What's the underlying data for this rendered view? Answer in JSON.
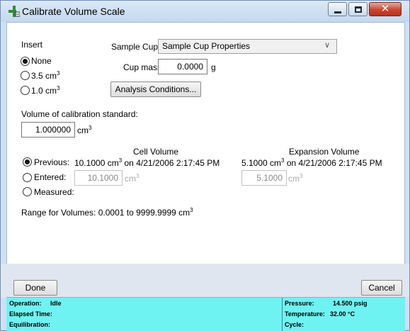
{
  "window": {
    "title": "Calibrate Volume Scale",
    "icon": "calibration-app-icon",
    "controls": [
      "minimize",
      "maximize",
      "close"
    ]
  },
  "insert": {
    "label": "Insert",
    "options": [
      {
        "label": "None",
        "checked": true
      },
      {
        "label": "3.5 cm",
        "sup": "3",
        "checked": false
      },
      {
        "label": "1.0 cm",
        "sup": "3",
        "checked": false
      }
    ]
  },
  "sample_cup": {
    "label": "Sample Cup",
    "selected": "Sample Cup Properties"
  },
  "cup_mass": {
    "label": "Cup mass:",
    "value": "0.0000",
    "unit": "g"
  },
  "analysis_button": "Analysis Conditions...",
  "calibration_standard": {
    "label": "Volume of calibration standard:",
    "value": "1.000000",
    "unit": "cm",
    "sup": "3"
  },
  "volumes": {
    "cell_header": "Cell Volume",
    "expansion_header": "Expansion Volume",
    "previous": {
      "label": "Previous:",
      "checked": true,
      "cell": "10.1000 cm",
      "cell_date": " on 4/21/2006 2:17:45 PM",
      "expansion": "5.1000 cm",
      "expansion_date": " on 4/21/2006 2:17:45 PM"
    },
    "entered": {
      "label": "Entered:",
      "checked": false,
      "cell_value": "10.1000",
      "expansion_value": "5.1000",
      "unit": "cm"
    },
    "measured": {
      "label": "Measured:",
      "checked": false
    },
    "sup": "3"
  },
  "range_text": "Range for Volumes: 0.0001 to 9999.9999 cm",
  "range_sup": "3",
  "buttons": {
    "done": "Done",
    "cancel": "Cancel"
  },
  "status": {
    "operation_label": "Operation:",
    "operation_value": "Idle",
    "elapsed_label": "Elapsed Time:",
    "equilibration_label": "Equilibration:",
    "pressure_label": "Pressure:",
    "pressure_value": "14.500 psig",
    "temperature_label": "Temperature:",
    "temperature_value": "32.00 °C",
    "cycle_label": "Cycle:"
  },
  "colors": {
    "status_bar": "#6ff2f2",
    "title_bar": "#c4d8ee",
    "close_button": "#c9452f"
  }
}
